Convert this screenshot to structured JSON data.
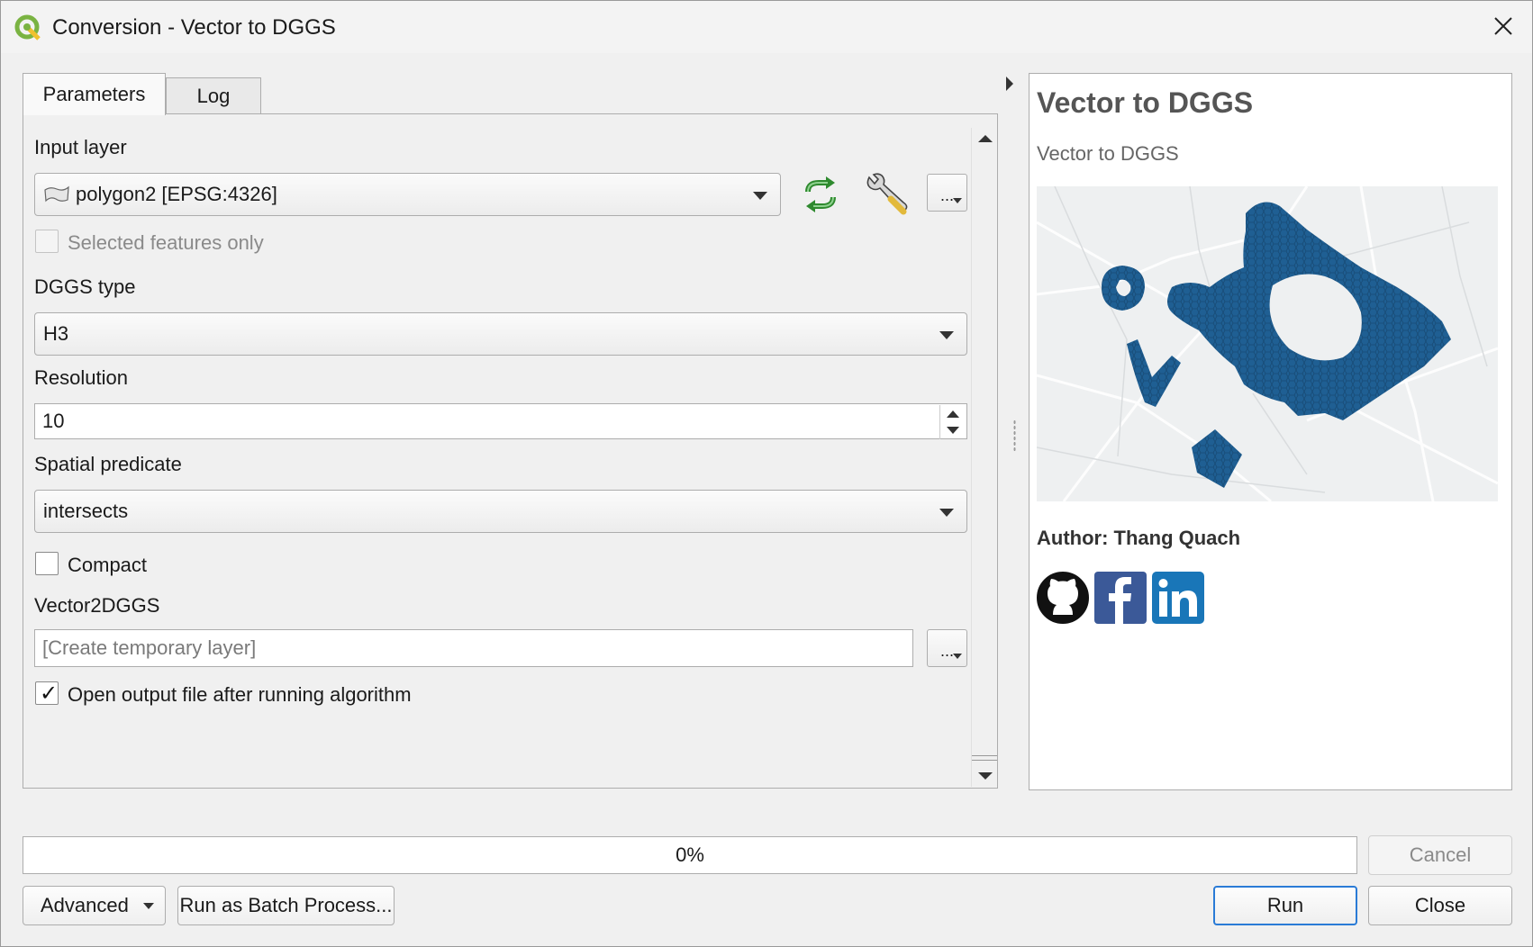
{
  "window": {
    "title": "Conversion - Vector to DGGS",
    "app_icon": "qgis-logo-icon",
    "close_icon": "close-icon"
  },
  "tabs": [
    {
      "label": "Parameters",
      "active": true
    },
    {
      "label": "Log",
      "active": false
    }
  ],
  "params": {
    "input_layer_label": "Input layer",
    "input_layer_value": "polygon2 [EPSG:4326]",
    "input_layer_icon": "polygon-layer-icon",
    "iterate_icon": "iterate-features-icon",
    "advanced_icon": "wrench-icon",
    "browse_label": "...",
    "selected_only_label": "Selected features only",
    "selected_only_checked": false,
    "dggs_type_label": "DGGS type",
    "dggs_type_value": "H3",
    "resolution_label": "Resolution",
    "resolution_value": "10",
    "predicate_label": "Spatial predicate",
    "predicate_value": "intersects",
    "compact_label": "Compact",
    "compact_checked": false,
    "output_label": "Vector2DGGS",
    "output_placeholder": "[Create temporary layer]",
    "open_output_label": "Open output file after running algorithm",
    "open_output_checked": true
  },
  "help": {
    "title": "Vector to DGGS",
    "subtitle": "Vector to DGGS",
    "author": "Author: Thang Quach",
    "social_icons": [
      "github-icon",
      "facebook-icon",
      "linkedin-icon"
    ],
    "map_fill_color": "#1f5f93"
  },
  "footer": {
    "progress_text": "0%",
    "progress_value": 0,
    "cancel_label": "Cancel",
    "advanced_label": "Advanced",
    "batch_label": "Run as Batch Process...",
    "run_label": "Run",
    "close_label": "Close"
  }
}
